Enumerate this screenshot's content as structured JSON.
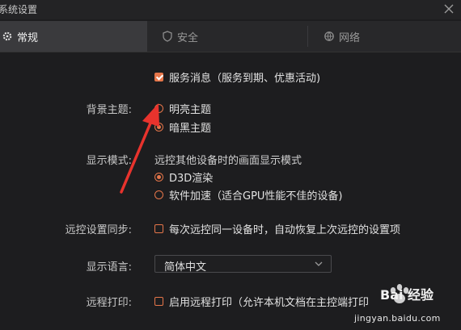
{
  "window": {
    "title": "系统设置"
  },
  "tabs": [
    {
      "label": "常规",
      "icon": "gear-icon"
    },
    {
      "label": "安全",
      "icon": "shield-icon"
    },
    {
      "label": "网络",
      "icon": "globe-icon"
    }
  ],
  "service_notice": {
    "label": "服务消息（服务到期、优惠活动)",
    "checked": true
  },
  "theme": {
    "label": "背景主题:",
    "options": [
      {
        "label": "明亮主题",
        "selected": false
      },
      {
        "label": "暗黑主题",
        "selected": true
      }
    ]
  },
  "display_mode": {
    "label": "显示模式:",
    "description": "远控其他设备时的画面显示模式",
    "options": [
      {
        "label": "D3D渲染",
        "selected": true
      },
      {
        "label": "软件加速（适合GPU性能不佳的设备)",
        "selected": false
      }
    ]
  },
  "remote_sync": {
    "label": "远控设置同步:",
    "option": {
      "label": "每次远控同一设备时，自动恢复上次远控的设置项",
      "checked": false
    }
  },
  "language": {
    "label": "显示语言:",
    "value": "简体中文"
  },
  "remote_print": {
    "label": "远程打印:",
    "option": {
      "label": "启用远程打印（允许本机文档在主控端打印",
      "checked": false
    }
  },
  "watermark": {
    "brand": "Bai 经验",
    "site": "jingyan.baidu.com"
  },
  "colors": {
    "accent": "#e6764a",
    "background": "#1d1d1f",
    "arrow": "#e8332d"
  }
}
